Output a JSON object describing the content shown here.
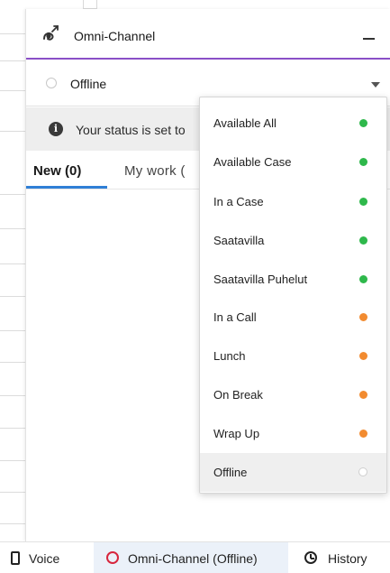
{
  "header": {
    "title": "Omni-Channel"
  },
  "status": {
    "current": "Offline"
  },
  "notice": {
    "text": "Your status is set to"
  },
  "tabs": [
    {
      "label": "New (0)"
    },
    {
      "label": "My work ("
    }
  ],
  "dropdown": {
    "options": [
      {
        "label": "Available All",
        "color": "#2eb84b"
      },
      {
        "label": "Available Case",
        "color": "#2eb84b"
      },
      {
        "label": "In a Case",
        "color": "#2eb84b"
      },
      {
        "label": "Saatavilla",
        "color": "#2eb84b"
      },
      {
        "label": "Saatavilla Puhelut",
        "color": "#2eb84b"
      },
      {
        "label": "In a Call",
        "color": "#f28b30"
      },
      {
        "label": "Lunch",
        "color": "#f28b30"
      },
      {
        "label": "On Break",
        "color": "#f28b30"
      },
      {
        "label": "Wrap Up",
        "color": "#f28b30"
      },
      {
        "label": "Offline",
        "color": "#ffffff"
      }
    ]
  },
  "utility_bar": {
    "voice": "Voice",
    "omni": "Omni-Channel (Offline)",
    "history": "History"
  },
  "colors": {
    "accent": "#8a4fc7",
    "tab_underline": "#2f7fd6",
    "online": "#2eb84b",
    "busy": "#f28b30",
    "offline_ring": "#d7263d"
  }
}
